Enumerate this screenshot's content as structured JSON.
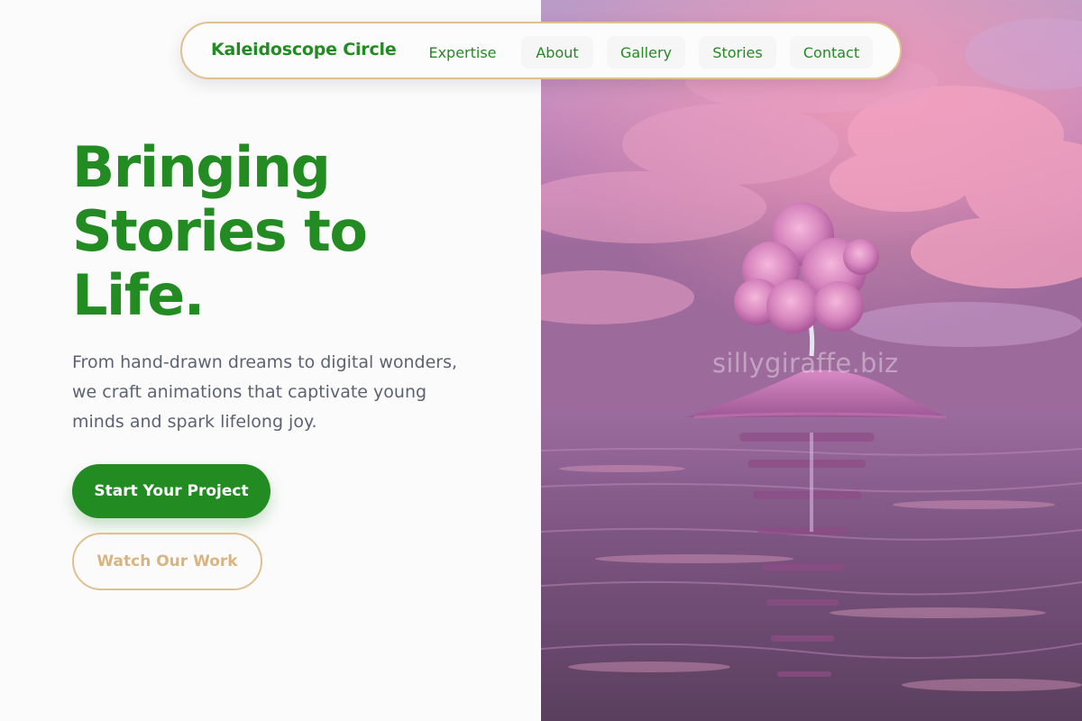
{
  "nav": {
    "brand": "Kaleidoscope Circle",
    "links": [
      "Expertise",
      "About",
      "Gallery",
      "Stories",
      "Contact"
    ]
  },
  "hero": {
    "headline_lines": [
      "Bringing",
      "Stories to",
      "Life."
    ],
    "subtext_lines": [
      "From hand-drawn dreams to digital wonders,",
      "we craft animations that captivate young",
      "minds and spark lifelong joy."
    ],
    "primary_button": "Start Your Project",
    "secondary_button": "Watch Our Work"
  },
  "image": {
    "watermark": "sillygiraffe.biz"
  },
  "colors": {
    "brand_green": "#228b22",
    "accent_tan": "#dfc091",
    "body_text": "#5b6373"
  }
}
